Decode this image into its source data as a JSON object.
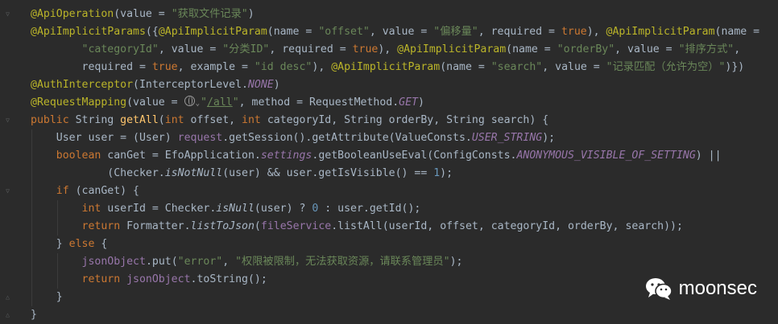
{
  "editor": {
    "lines": [
      [
        {
          "t": "@ApiOperation",
          "c": "ann"
        },
        {
          "t": "(value = "
        },
        {
          "t": "\"获取文件记录\"",
          "c": "str"
        },
        {
          "t": ")"
        }
      ],
      [
        {
          "t": "@ApiImplicitParams",
          "c": "ann"
        },
        {
          "t": "({"
        },
        {
          "t": "@ApiImplicitParam",
          "c": "ann"
        },
        {
          "t": "(name = "
        },
        {
          "t": "\"offset\"",
          "c": "str"
        },
        {
          "t": ", value = "
        },
        {
          "t": "\"偏移量\"",
          "c": "str"
        },
        {
          "t": ", required = "
        },
        {
          "t": "true",
          "c": "kw"
        },
        {
          "t": "), "
        },
        {
          "t": "@ApiImplicitParam",
          "c": "ann"
        },
        {
          "t": "(name ="
        }
      ],
      [
        {
          "t": "        "
        },
        {
          "t": "\"categoryId\"",
          "c": "str"
        },
        {
          "t": ", value = "
        },
        {
          "t": "\"分类ID\"",
          "c": "str"
        },
        {
          "t": ", required = "
        },
        {
          "t": "true",
          "c": "kw"
        },
        {
          "t": "), "
        },
        {
          "t": "@ApiImplicitParam",
          "c": "ann"
        },
        {
          "t": "(name = "
        },
        {
          "t": "\"orderBy\"",
          "c": "str"
        },
        {
          "t": ", value = "
        },
        {
          "t": "\"排序方式\"",
          "c": "str"
        },
        {
          "t": ","
        }
      ],
      [
        {
          "t": "        required = "
        },
        {
          "t": "true",
          "c": "kw"
        },
        {
          "t": ", example = "
        },
        {
          "t": "\"id desc\"",
          "c": "str"
        },
        {
          "t": "), "
        },
        {
          "t": "@ApiImplicitParam",
          "c": "ann"
        },
        {
          "t": "(name = "
        },
        {
          "t": "\"search\"",
          "c": "str"
        },
        {
          "t": ", value = "
        },
        {
          "t": "\"记录匹配（允许为空）\"",
          "c": "str"
        },
        {
          "t": ")})"
        }
      ],
      [
        {
          "t": "@AuthInterceptor",
          "c": "ann"
        },
        {
          "t": "(InterceptorLevel."
        },
        {
          "t": "NONE",
          "c": "const"
        },
        {
          "t": ")"
        }
      ],
      [
        {
          "t": "@RequestMapping",
          "c": "ann"
        },
        {
          "t": "(value = "
        },
        {
          "t": "",
          "c": "globe"
        },
        {
          "t": "\"",
          "c": "str"
        },
        {
          "t": "/all",
          "c": "url"
        },
        {
          "t": "\"",
          "c": "str"
        },
        {
          "t": ", method = RequestMethod."
        },
        {
          "t": "GET",
          "c": "const"
        },
        {
          "t": ")"
        }
      ],
      [
        {
          "t": "public ",
          "c": "kw"
        },
        {
          "t": "String "
        },
        {
          "t": "getAll",
          "c": "fn"
        },
        {
          "t": "("
        },
        {
          "t": "int ",
          "c": "kw"
        },
        {
          "t": "offset, "
        },
        {
          "t": "int ",
          "c": "kw"
        },
        {
          "t": "categoryId, String orderBy, String search) {"
        }
      ],
      [
        {
          "t": "    User user = (User) "
        },
        {
          "t": "request",
          "c": "field"
        },
        {
          "t": ".getSession().getAttribute(ValueConsts."
        },
        {
          "t": "USER_STRING",
          "c": "const"
        },
        {
          "t": ");"
        }
      ],
      [
        {
          "t": "    "
        },
        {
          "t": "boolean ",
          "c": "kw"
        },
        {
          "t": "canGet = EfoApplication."
        },
        {
          "t": "settings",
          "c": "const"
        },
        {
          "t": ".getBooleanUseEval(ConfigConsts."
        },
        {
          "t": "ANONYMOUS_VISIBLE_OF_SETTING",
          "c": "const"
        },
        {
          "t": ") ||"
        }
      ],
      [
        {
          "t": "            (Checker."
        },
        {
          "t": "isNotNull",
          "c": "ital"
        },
        {
          "t": "(user) && user.getIsVisible() == "
        },
        {
          "t": "1",
          "c": "num"
        },
        {
          "t": ");"
        }
      ],
      [
        {
          "t": "    "
        },
        {
          "t": "if ",
          "c": "kw"
        },
        {
          "t": "(canGet) {"
        }
      ],
      [
        {
          "t": "        "
        },
        {
          "t": "int ",
          "c": "kw"
        },
        {
          "t": "userId = Checker."
        },
        {
          "t": "isNull",
          "c": "ital"
        },
        {
          "t": "(user) ? "
        },
        {
          "t": "0",
          "c": "num"
        },
        {
          "t": " : user.getId();"
        }
      ],
      [
        {
          "t": "        "
        },
        {
          "t": "return ",
          "c": "kw"
        },
        {
          "t": "Formatter."
        },
        {
          "t": "listToJson",
          "c": "ital"
        },
        {
          "t": "("
        },
        {
          "t": "fileService",
          "c": "field"
        },
        {
          "t": ".listAll(userId, offset, categoryId, orderBy, search));"
        }
      ],
      [
        {
          "t": "    } "
        },
        {
          "t": "else ",
          "c": "kw"
        },
        {
          "t": "{"
        }
      ],
      [
        {
          "t": "        "
        },
        {
          "t": "jsonObject",
          "c": "field"
        },
        {
          "t": ".put("
        },
        {
          "t": "\"error\"",
          "c": "str"
        },
        {
          "t": ", "
        },
        {
          "t": "\"权限被限制，无法获取资源，请联系管理员\"",
          "c": "str"
        },
        {
          "t": ");"
        }
      ],
      [
        {
          "t": "        "
        },
        {
          "t": "return ",
          "c": "kw"
        },
        {
          "t": "jsonObject",
          "c": "field"
        },
        {
          "t": ".toString();"
        }
      ],
      [
        {
          "t": "    }"
        }
      ],
      [
        {
          "t": "}"
        }
      ]
    ]
  },
  "watermark": {
    "text": "moonsec",
    "icon": "wechat-icon"
  },
  "colors": {
    "background": "#2b2b2b",
    "default_text": "#a9b7c6",
    "annotation": "#bbb529",
    "keyword": "#cc7832",
    "string": "#6a8759",
    "number": "#6897bb",
    "method_decl": "#ffc66d",
    "field_const": "#9876aa"
  }
}
